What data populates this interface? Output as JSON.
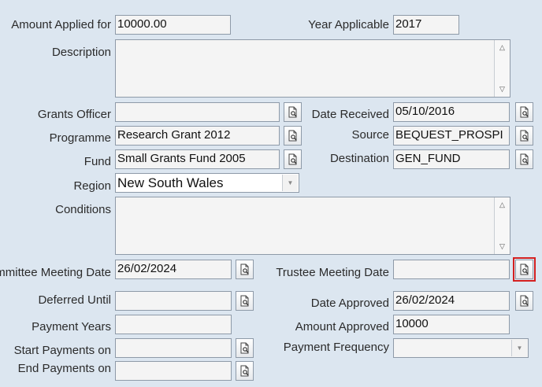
{
  "form": {
    "amount_applied": {
      "label": "Amount Applied for",
      "value": "10000.00"
    },
    "year_applicable": {
      "label": "Year Applicable",
      "value": "2017"
    },
    "description": {
      "label": "Description",
      "value": ""
    },
    "grants_officer": {
      "label": "Grants Officer",
      "value": ""
    },
    "date_received": {
      "label": "Date Received",
      "value": "05/10/2016"
    },
    "programme": {
      "label": "Programme",
      "value": "Research Grant 2012"
    },
    "source": {
      "label": "Source",
      "value": "BEQUEST_PROSPI"
    },
    "fund": {
      "label": "Fund",
      "value": "Small Grants Fund 2005"
    },
    "destination": {
      "label": "Destination",
      "value": "GEN_FUND"
    },
    "region": {
      "label": "Region",
      "value": "New South Wales"
    },
    "conditions": {
      "label": "Conditions",
      "value": ""
    },
    "committee_meeting_date": {
      "label": "ommittee Meeting Date",
      "value": "26/02/2024"
    },
    "trustee_meeting_date": {
      "label": "Trustee Meeting Date",
      "value": ""
    },
    "deferred_until": {
      "label": "Deferred Until",
      "value": ""
    },
    "date_approved": {
      "label": "Date Approved",
      "value": "26/02/2024"
    },
    "payment_years": {
      "label": "Payment Years",
      "value": ""
    },
    "amount_approved": {
      "label": "Amount Approved",
      "value": "10000"
    },
    "start_payments_on": {
      "label": "Start Payments on",
      "value": ""
    },
    "payment_frequency": {
      "label": "Payment Frequency",
      "value": ""
    },
    "end_payments_on": {
      "label": "End Payments on",
      "value": ""
    }
  },
  "icons": {
    "lov_button": "lookup-document-icon",
    "scroll_up": "scroll-up-arrow-icon",
    "scroll_down": "scroll-down-arrow-icon",
    "dropdown": "dropdown-arrow-icon"
  },
  "colors": {
    "background": "#dce6f0",
    "highlight": "#d42020"
  }
}
